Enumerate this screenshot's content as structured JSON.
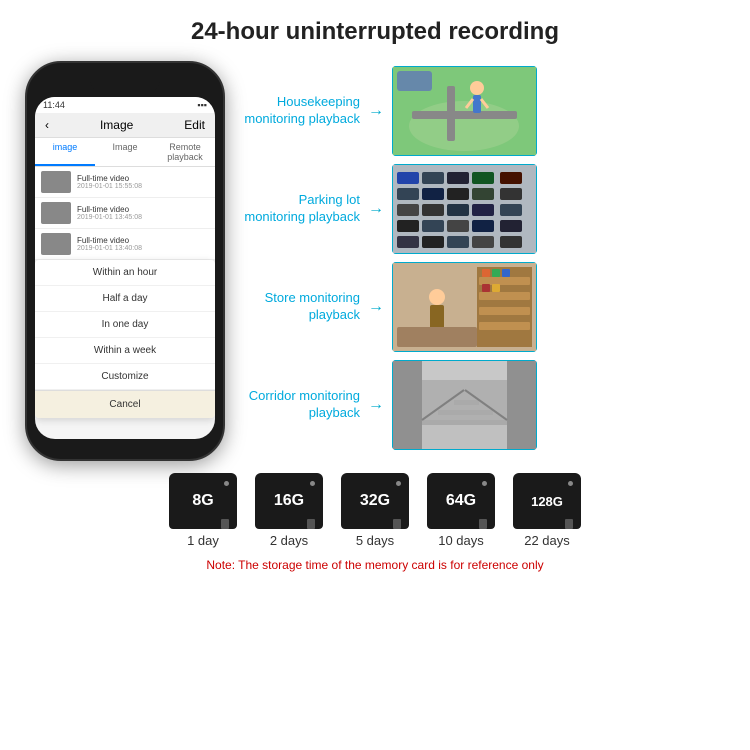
{
  "header": {
    "title": "24-hour uninterrupted recording"
  },
  "phone": {
    "status_time": "11:44",
    "app_title": "Image",
    "app_edit": "Edit",
    "tabs": [
      "image",
      "Image",
      "Remote playback"
    ],
    "list_items": [
      {
        "title": "Full-time video",
        "time": "2019-01-01 15:55:08"
      },
      {
        "title": "Full-time video",
        "time": "2019-01-01 13:45:08"
      },
      {
        "title": "Full-time video",
        "time": "2019-01-01 13:40:08"
      }
    ],
    "dropdown": {
      "items": [
        "Within an hour",
        "Half a day",
        "In one day",
        "Within a week",
        "Customize"
      ],
      "cancel": "Cancel"
    }
  },
  "monitoring": [
    {
      "label": "Housekeeping\nmonitoring playback",
      "img_type": "housekeeping"
    },
    {
      "label": "Parking lot\nmonitoring playback",
      "img_type": "parking"
    },
    {
      "label": "Store monitoring\nplayback",
      "img_type": "store"
    },
    {
      "label": "Corridor monitoring\nplayback",
      "img_type": "corridor"
    }
  ],
  "storage": {
    "cards": [
      {
        "size": "8G",
        "days": "1 day"
      },
      {
        "size": "16G",
        "days": "2 days"
      },
      {
        "size": "32G",
        "days": "5 days"
      },
      {
        "size": "64G",
        "days": "10 days"
      },
      {
        "size": "128G",
        "days": "22 days"
      }
    ],
    "note": "Note: The storage time of the memory card is for reference only"
  }
}
